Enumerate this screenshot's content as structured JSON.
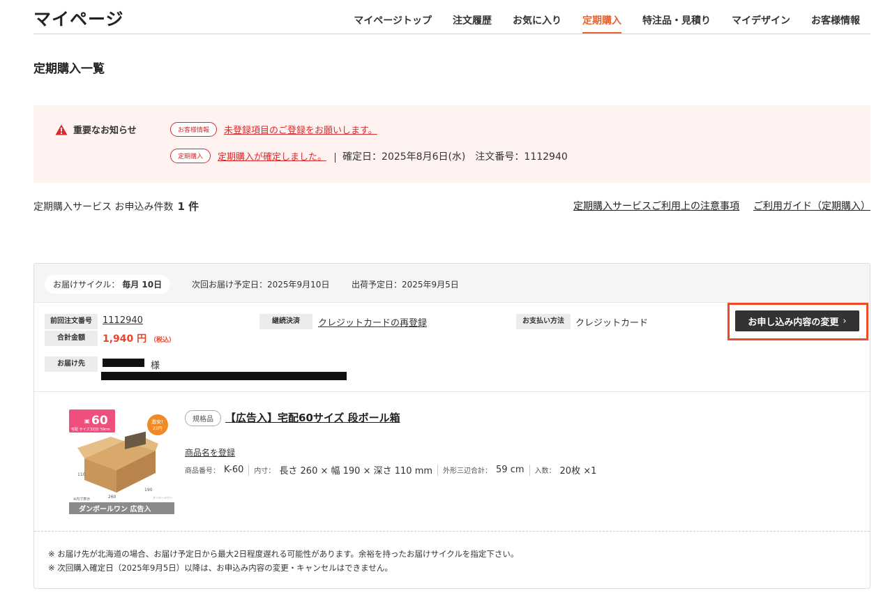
{
  "header": {
    "site_title": "マイページ",
    "nav": [
      {
        "label": "マイページトップ",
        "active": false
      },
      {
        "label": "注文履歴",
        "active": false
      },
      {
        "label": "お気に入り",
        "active": false
      },
      {
        "label": "定期購入",
        "active": true
      },
      {
        "label": "特注品・見積り",
        "active": false
      },
      {
        "label": "マイデザイン",
        "active": false
      },
      {
        "label": "お客様情報",
        "active": false
      }
    ]
  },
  "page": {
    "heading": "定期購入一覧"
  },
  "notice": {
    "title": "重要なお知らせ",
    "items": [
      {
        "tag": "お客様情報",
        "link": "未登録項目のご登録をお願いします。"
      },
      {
        "tag": "定期購入",
        "link": "定期購入が確定しました。",
        "confirm_date": "確定日：2025年8月6日(水)",
        "order_no": "注文番号：1112940"
      }
    ]
  },
  "summary": {
    "label": "定期購入サービス お申込み件数",
    "count": "1 件",
    "links": [
      "定期購入サービスご利用上の注意事項",
      "ご利用ガイド（定期購入）"
    ]
  },
  "subscription": {
    "cycle_label": "お届けサイクル：",
    "cycle_value": "毎月 10日",
    "next_delivery": "次回お届け予定日：2025年9月10日",
    "ship_date": "出荷予定日：2025年9月5日",
    "prev_order_label": "前回注文番号",
    "prev_order_value": "1112940",
    "total_label": "合計金額",
    "total_value": "1,940 円",
    "tax_note": "（税込）",
    "payment_cont_label": "継続決済",
    "payment_cont_value": "クレジットカードの再登録",
    "payment_method_label": "お支払い方法",
    "payment_method_value": "クレジットカード",
    "change_button": "お申し込み内容の変更",
    "ship_to_label": "お届け先",
    "ship_to_suffix": "様",
    "product": {
      "std_tag": "規格品",
      "name": "【広告入】宅配60サイズ 段ボール箱",
      "register_name": "商品名を登録",
      "code_label": "商品番号：",
      "code": "K-60",
      "inner_label": "内寸：",
      "inner": "長さ 260 × 幅 190 × 深さ 110 mm",
      "sum_label": "外形三辺合計：",
      "sum": "59 cm",
      "qty_label": "入数：",
      "qty": "20枚 ×1",
      "image": {
        "size_badge": "60",
        "size_sub": "宅配 サイズ",
        "sum_badge": "3辺計 59cm",
        "cheap_badge_1": "激安!",
        "cheap_badge_2": "23円",
        "dim_l": "260",
        "dim_w": "190",
        "dim_h": "110",
        "inner_note": "※内寸表示",
        "brand": "ダンボールワン 広告入",
        "box_print": "ダンボールワン"
      }
    },
    "footnotes": [
      "※ お届け先が北海道の場合、お届け予定日から最大2日程度遅れる可能性があります。余裕を持ったお届けサイクルを指定下さい。",
      "※ 次回購入確定日（2025年9月5日）以降は、お申込み内容の変更・キャンセルはできません。"
    ]
  },
  "colors": {
    "accent": "#e8612c",
    "alert_red": "#d92b2b",
    "price_red": "#e8452b",
    "highlight_border": "#ee4a2a",
    "notice_bg": "#fff3f1"
  }
}
